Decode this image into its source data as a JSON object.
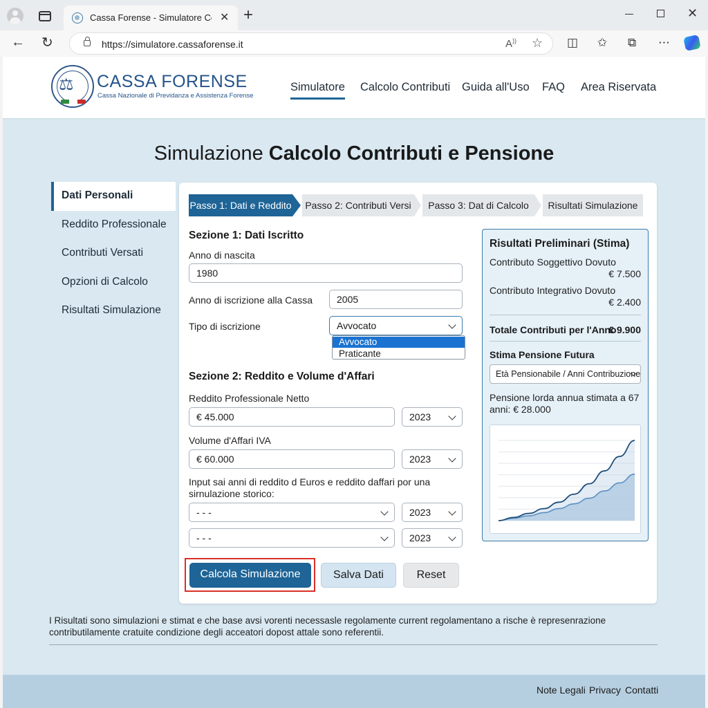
{
  "browser": {
    "tab_title": "Cassa Forense - Simulatore Cont",
    "url": "https://simulatore.cassaforense.it"
  },
  "brand": {
    "name": "CASSA FORENSE",
    "subtitle": "Cassa Nazionale di Previdanza e Assistenza Forense"
  },
  "main_nav": [
    "Simulatore",
    "Calcolo Contributi",
    "Guida all'Uso",
    "FAQ",
    "Area Riservata"
  ],
  "page_title": {
    "light": "Simulazione ",
    "bold": "Calcolo Contributi e Pensione"
  },
  "sidebar": [
    "Dati Personali",
    "Reddito Professionale",
    "Contributi Versati",
    "Opzioni di Calcolo",
    "Risultati Simulazione"
  ],
  "steps": [
    "Passo 1: Dati e Reddito",
    "Passo 2: Contributi Versi",
    "Passo 3: Dat di Calcolo",
    "Risultati Simulazione"
  ],
  "section1": {
    "title": "Sezione 1: Dati Iscritto",
    "birth_label": "Anno di nascita",
    "birth_value": "1980",
    "enroll_label": "Anno di iscrizione alla Cassa",
    "enroll_value": "2005",
    "type_label": "Tipo di iscrizione",
    "type_value": "Avvocato",
    "type_options": [
      "Avvocato",
      "Praticante"
    ]
  },
  "section2": {
    "title": "Sezione 2: Reddito e Volume d'Affari",
    "income_label": "Reddito Professionale Netto",
    "income_value": "€  45.000",
    "income_year": "2023",
    "vat_label": "Volume d'Affari IVA",
    "vat_value": "€  60.000",
    "vat_year": "2023",
    "history_label": "Input sai anni di reddito d Euros e reddito daffari por una sirnulazione storico:",
    "history_rows": [
      {
        "value": "- - -",
        "year": "2023"
      },
      {
        "value": "- - -",
        "year": "2023"
      }
    ]
  },
  "buttons": {
    "calculate": "Calcola Simulazione",
    "save": "Salva Dati",
    "reset": "Reset"
  },
  "results": {
    "title": "Risultati Preliminari (Stima)",
    "subj_label": "Contributo Soggettivo Dovuto",
    "subj_value": "€ 7.500",
    "integ_label": "Contributo Integrativo Dovuto",
    "integ_value": "€ 2.400",
    "total_label": "Totale Contributi per l'Anno",
    "total_value": "€ 9.900",
    "pension_title": "Stima Pensione Futura",
    "pension_select": "Età Pensionabile / Anni Contribuzione",
    "pension_text": "Pensione lorda annua stimata a 67 anni: € 28.000"
  },
  "chart_data": {
    "type": "area",
    "series": [
      {
        "values": [
          0,
          0.04,
          0.09,
          0.15,
          0.23,
          0.33,
          0.46,
          0.62,
          0.8,
          1.0
        ]
      },
      {
        "values": [
          0,
          0.03,
          0.06,
          0.1,
          0.15,
          0.21,
          0.28,
          0.37,
          0.47,
          0.58
        ]
      }
    ],
    "grid": true,
    "colors": {
      "line_dark": "#1f4e7a",
      "line_light": "#5b8fc4",
      "fill": "#aec8e0"
    }
  },
  "disclaimer": "I Risultati sono simulazioni e stimat e che base avsi vorenti necessasle regolamente current regolamentano a rische è represenrazione contributilamente cratuite condizione degli acceatori dopost attale sono referentii.",
  "footer": [
    "Note Legali",
    "Privacy",
    "Contatti"
  ],
  "colors": {
    "primary": "#1e6496",
    "page_bg": "#d9e8f1",
    "highlight": "#d93025"
  }
}
